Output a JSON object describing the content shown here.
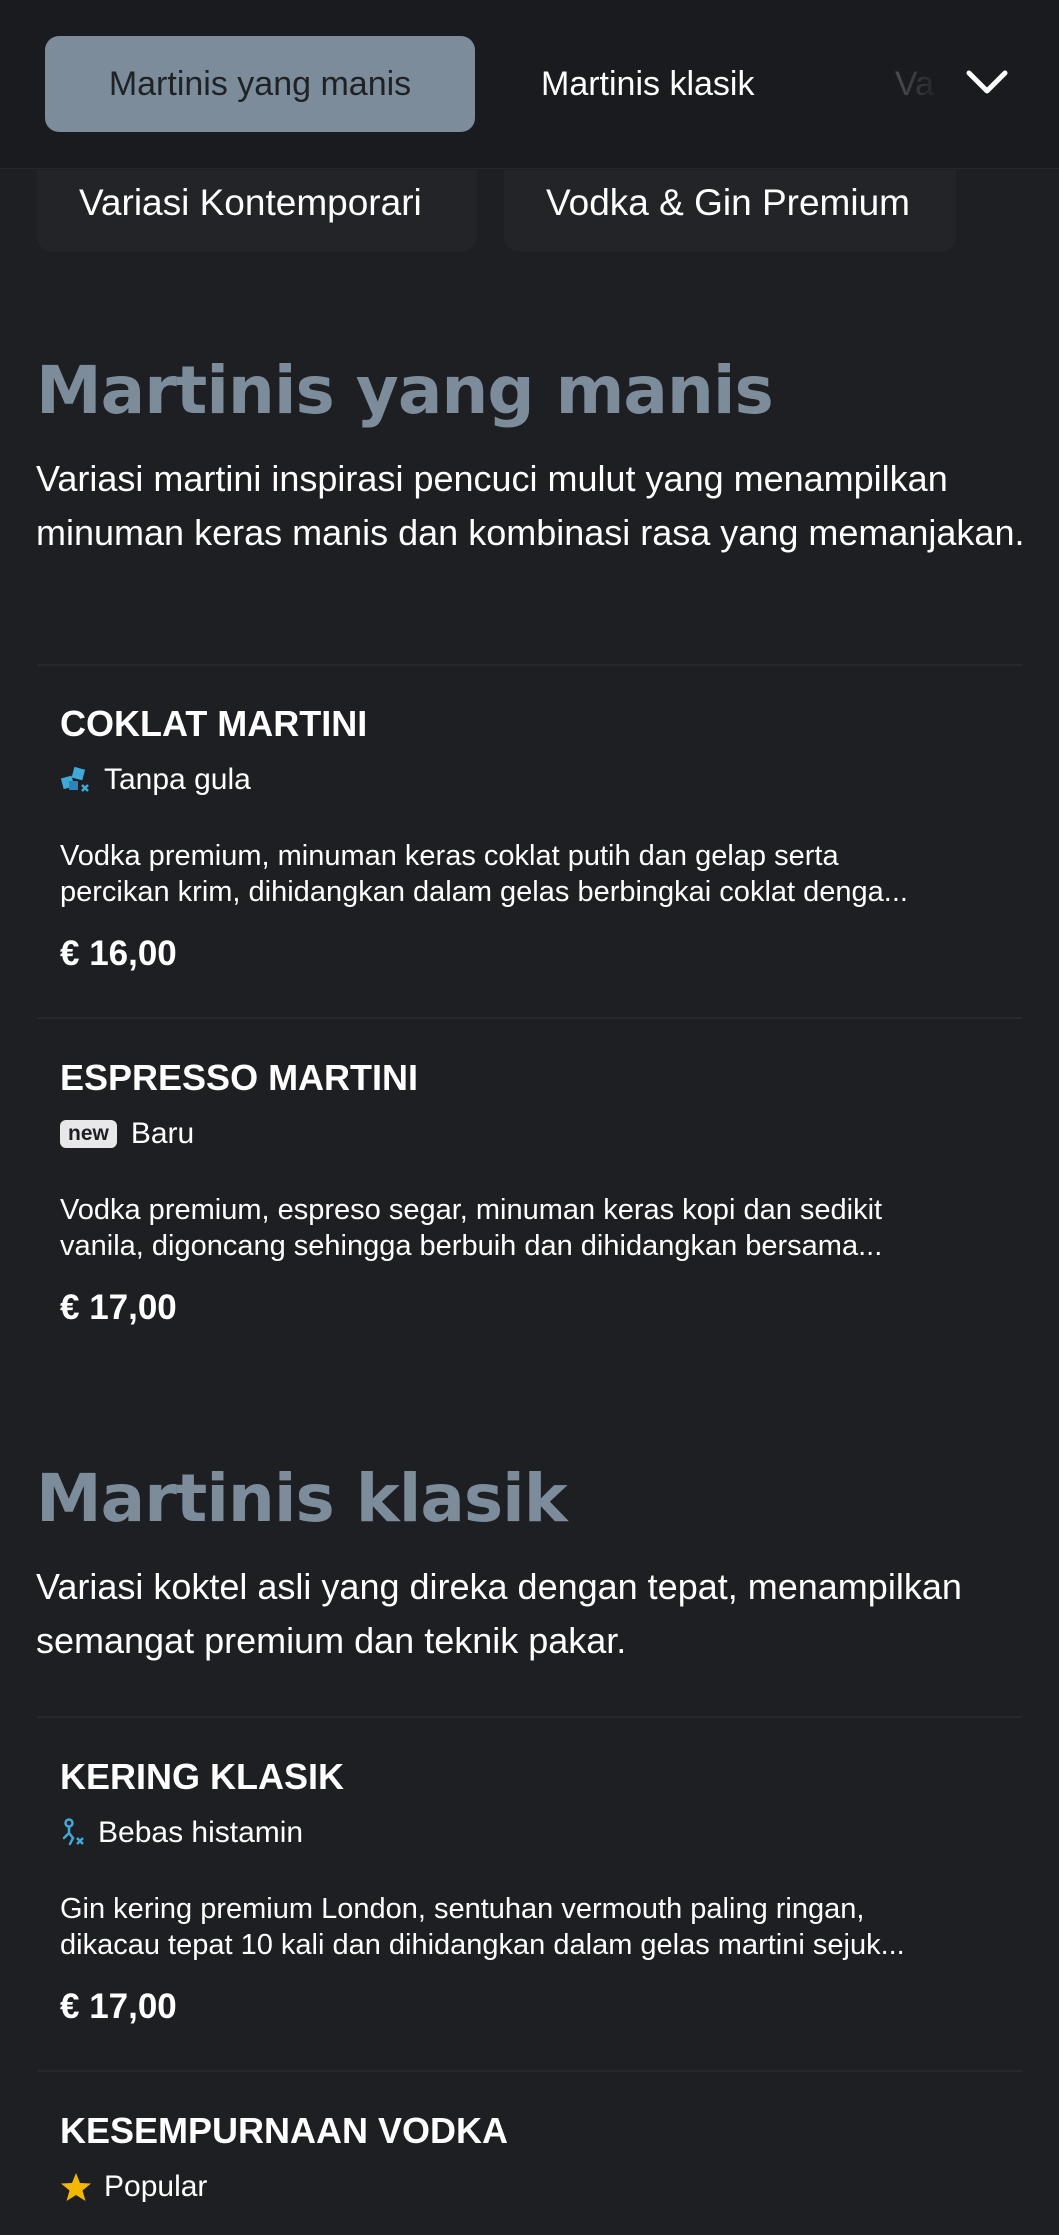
{
  "nav": {
    "tabs": [
      "Martinis yang manis",
      "Martinis klasik",
      "Va"
    ],
    "subtabs": [
      "Variasi Kontemporari",
      "Vodka & Gin Premium"
    ],
    "expand_icon": "chevron-down-icon"
  },
  "sections": [
    {
      "title": "Martinis yang manis",
      "description": "Variasi martini inspirasi pencuci mulut yang menampilkan minuman keras manis dan kombinasi rasa yang memanjakan.",
      "items": [
        {
          "name": "COKLAT MARTINI",
          "tag_icon": "sugar-free-icon",
          "tag_label": "Tanpa gula",
          "desc_line1": "Vodka premium, minuman keras coklat putih dan gelap serta",
          "desc_line2": "percikan krim, dihidangkan dalam gelas berbingkai coklat denga...",
          "price": "€ 16,00"
        },
        {
          "name": "ESPRESSO MARTINI",
          "tag_badge": "new",
          "tag_label": "Baru",
          "desc_line1": "Vodka premium, espreso segar, minuman keras kopi dan sedikit",
          "desc_line2": "vanila, digoncang sehingga berbuih dan dihidangkan bersama...",
          "price": "€ 17,00"
        }
      ]
    },
    {
      "title": "Martinis klasik",
      "description": "Variasi koktel asli yang direka dengan tepat, menampilkan semangat premium dan teknik pakar.",
      "items": [
        {
          "name": "KERING KLASIK",
          "tag_icon": "histamine-free-icon",
          "tag_label": "Bebas histamin",
          "desc_line1": "Gin kering premium London, sentuhan vermouth paling ringan,",
          "desc_line2": "dikacau tepat 10 kali dan dihidangkan dalam gelas martini sejuk...",
          "price": "€ 17,00"
        },
        {
          "name": "KESEMPURNAAN VODKA",
          "tag_icon": "star-icon",
          "tag_label": "Popular"
        }
      ]
    }
  ],
  "colors": {
    "background": "#1e1f22",
    "accent": "#7c8c9a",
    "icon_blue": "#3fa9d8",
    "star": "#f5b800"
  }
}
